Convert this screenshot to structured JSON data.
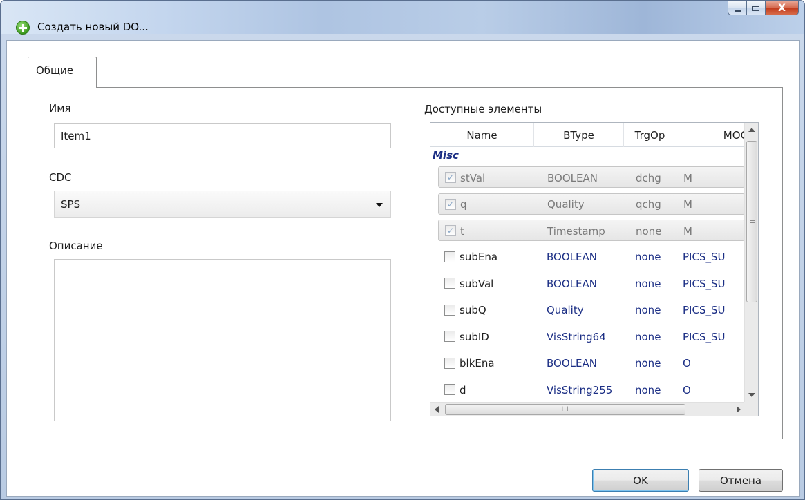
{
  "window": {
    "title": "Создать новый DO...",
    "icon": "add-icon",
    "controls": {
      "close_label": "X"
    }
  },
  "tabs": [
    {
      "label": "Общие",
      "selected": true
    }
  ],
  "form": {
    "name_label": "Имя",
    "name_value": "Item1",
    "cdc_label": "CDC",
    "cdc_value": "SPS",
    "description_label": "Описание",
    "description_value": ""
  },
  "available": {
    "label": "Доступные элементы",
    "columns": [
      "Name",
      "BType",
      "TrgOp",
      "MOC"
    ],
    "group": "Misc",
    "rows": [
      {
        "name": "stVal",
        "btype": "BOOLEAN",
        "trgop": "dchg",
        "moc": "M",
        "checked": true,
        "mandatory": true
      },
      {
        "name": "q",
        "btype": "Quality",
        "trgop": "qchg",
        "moc": "M",
        "checked": true,
        "mandatory": true
      },
      {
        "name": "t",
        "btype": "Timestamp",
        "trgop": "none",
        "moc": "M",
        "checked": true,
        "mandatory": true
      },
      {
        "name": "subEna",
        "btype": "BOOLEAN",
        "trgop": "none",
        "moc": "PICS_SU",
        "checked": false,
        "mandatory": false
      },
      {
        "name": "subVal",
        "btype": "BOOLEAN",
        "trgop": "none",
        "moc": "PICS_SU",
        "checked": false,
        "mandatory": false
      },
      {
        "name": "subQ",
        "btype": "Quality",
        "trgop": "none",
        "moc": "PICS_SU",
        "checked": false,
        "mandatory": false
      },
      {
        "name": "subID",
        "btype": "VisString64",
        "trgop": "none",
        "moc": "PICS_SU",
        "checked": false,
        "mandatory": false
      },
      {
        "name": "blkEna",
        "btype": "BOOLEAN",
        "trgop": "none",
        "moc": "O",
        "checked": false,
        "mandatory": false
      },
      {
        "name": "d",
        "btype": "VisString255",
        "trgop": "none",
        "moc": "O",
        "checked": false,
        "mandatory": false
      }
    ],
    "hscroll_grip": "III"
  },
  "buttons": {
    "ok": "OK",
    "cancel": "Отмена"
  }
}
